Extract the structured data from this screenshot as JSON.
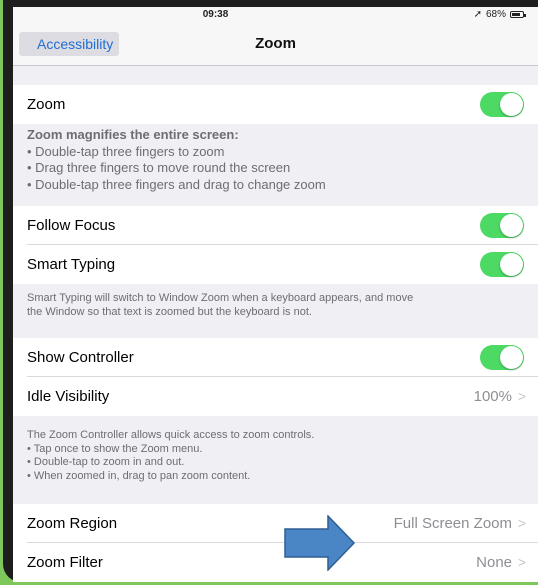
{
  "status_bar": {
    "time": "09:38",
    "location_glyph": "➚",
    "battery": "68%"
  },
  "nav": {
    "back_label": "Accessibility",
    "title": "Zoom"
  },
  "zoom_group": {
    "label": "Zoom",
    "on": true
  },
  "zoom_footer": {
    "heading": "Zoom magnifies the entire screen:",
    "lines": [
      "• Double-tap three fingers to zoom",
      "• Drag three fingers to move round the screen",
      "• Double-tap three fingers and drag to change zoom"
    ]
  },
  "focus_group": {
    "follow_focus": {
      "label": "Follow Focus",
      "on": true
    },
    "smart_typing": {
      "label": "Smart Typing",
      "on": true
    }
  },
  "smart_typing_footer": [
    "Smart Typing will switch to Window Zoom when a keyboard appears, and move",
    "the Window so that text is zoomed but the keyboard is not."
  ],
  "controller_group": {
    "show_controller": {
      "label": "Show Controller",
      "on": true
    },
    "idle_visibility": {
      "label": "Idle Visibility",
      "value": "100%"
    }
  },
  "controller_footer": [
    "The Zoom Controller allows quick access to zoom controls.",
    "• Tap once to show the Zoom menu.",
    "• Double-tap to zoom in and out.",
    "• When zoomed in, drag to pan zoom content."
  ],
  "region_group": {
    "zoom_region": {
      "label": "Zoom Region",
      "value": "Full Screen Zoom"
    },
    "zoom_filter": {
      "label": "Zoom Filter",
      "value": "None"
    }
  },
  "chevron_glyph": ">",
  "colors": {
    "toggle_on": "#4cd964",
    "accent": "#1f6ed4",
    "arrow_fill": "#4a86c5",
    "arrow_stroke": "#2f5f93",
    "frame_green": "#7cc85a"
  }
}
